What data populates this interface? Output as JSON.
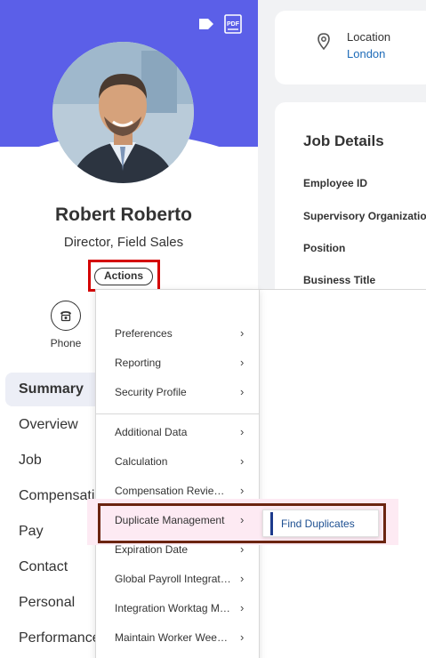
{
  "profile": {
    "name": "Robert Roberto",
    "title": "Director, Field Sales",
    "actions_label": "Actions",
    "phone_label": "Phone",
    "tag_icon": "tag-icon",
    "pdf_icon": "pdf-icon",
    "hero_color": "#5b5fe8"
  },
  "nav": {
    "items": [
      {
        "label": "Summary",
        "active": true
      },
      {
        "label": "Overview"
      },
      {
        "label": "Job"
      },
      {
        "label": "Compensation"
      },
      {
        "label": "Pay"
      },
      {
        "label": "Contact"
      },
      {
        "label": "Personal"
      },
      {
        "label": "Performance"
      }
    ]
  },
  "location": {
    "label": "Location",
    "value": "London",
    "icon": "location-pin-icon"
  },
  "job_details": {
    "title": "Job Details",
    "fields": [
      "Employee ID",
      "Supervisory Organization",
      "Position",
      "Business Title"
    ]
  },
  "menu": {
    "items": [
      {
        "label": "Preferences"
      },
      {
        "label": "Reporting"
      },
      {
        "label": "Security Profile"
      },
      {
        "label": "Additional Data"
      },
      {
        "label": "Calculation"
      },
      {
        "label": "Compensation Review Eligibility"
      },
      {
        "label": "Duplicate Management"
      },
      {
        "label": "Expiration Date"
      },
      {
        "label": "Global Payroll Integrations"
      },
      {
        "label": "Integration Worktag Mappings"
      },
      {
        "label": "Maintain Worker Weekly Hours"
      }
    ],
    "submenu": {
      "label": "Find Duplicates"
    }
  },
  "colors": {
    "accent": "#5b5fe8",
    "link": "#1d6bb8",
    "highlight_red": "#d40000",
    "highlight_brown": "#6b2410"
  }
}
